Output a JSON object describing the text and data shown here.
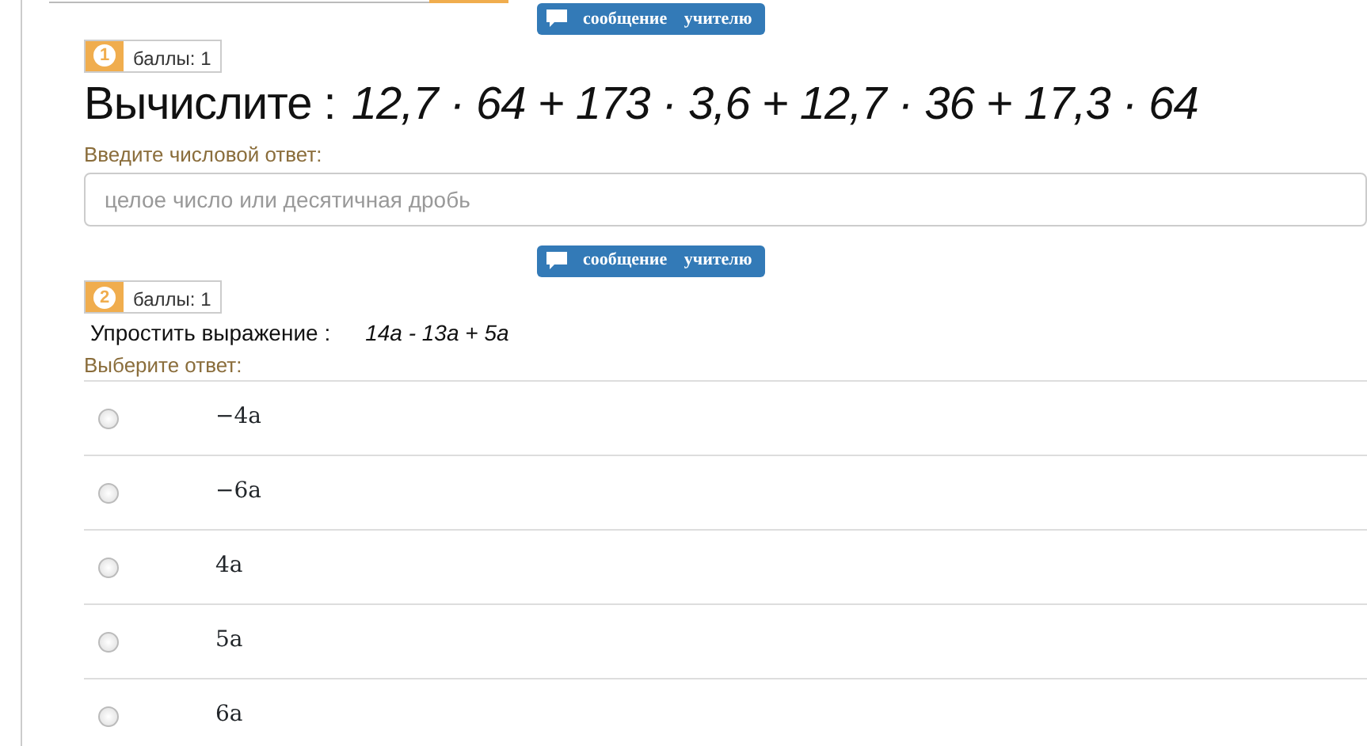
{
  "message_button": "сообщение учителю",
  "questions": [
    {
      "kind": "numeric",
      "number": "1",
      "points": "баллы: 1",
      "prompt": "Вычислите :",
      "expression": "12,7 · 64 + 173 · 3,6 + 12,7 · 36 + 17,3 · 64",
      "answer_label": "Введите числовой ответ:",
      "placeholder": "целое число или десятичная дробь",
      "message_button": "сообщение учителю"
    },
    {
      "kind": "choice",
      "number": "2",
      "points": "баллы: 1",
      "prompt": "Упростить выражение :",
      "expression": "14a - 13a + 5a",
      "answer_label": "Выберите ответ:",
      "options": [
        {
          "label": "−4a",
          "selected": false
        },
        {
          "label": "−6a",
          "selected": false
        },
        {
          "label": "4a",
          "selected": false
        },
        {
          "label": "5a",
          "selected": false
        },
        {
          "label": "6a",
          "selected": false
        }
      ]
    }
  ]
}
